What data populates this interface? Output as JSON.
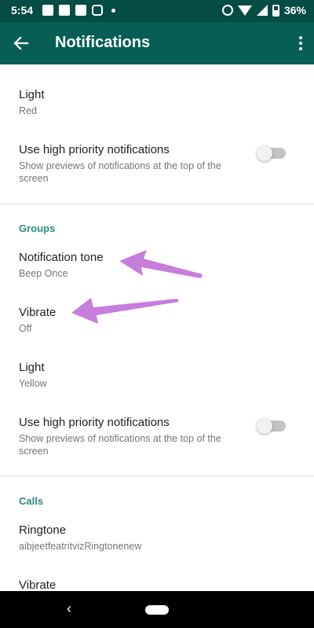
{
  "status_bar": {
    "time": "5:54",
    "battery": "36%",
    "left_icons": [
      "message-icon",
      "message-icon",
      "news-icon",
      "instagram-icon"
    ],
    "right_icons": [
      "alarm-icon",
      "wifi-icon",
      "signal-icon",
      "battery-icon"
    ]
  },
  "app_bar": {
    "title": "Notifications",
    "color": "#075e54"
  },
  "sections": {
    "top": {
      "light": {
        "title": "Light",
        "value": "Red"
      },
      "high_priority": {
        "title": "Use high priority notifications",
        "subtitle": "Show previews of notifications at the top of the screen",
        "enabled": false
      }
    },
    "groups": {
      "header": "Groups",
      "notification_tone": {
        "title": "Notification tone",
        "value": "Beep Once"
      },
      "vibrate": {
        "title": "Vibrate",
        "value": "Off"
      },
      "light": {
        "title": "Light",
        "value": "Yellow"
      },
      "high_priority": {
        "title": "Use high priority notifications",
        "subtitle": "Show previews of notifications at the top of the screen",
        "enabled": false
      }
    },
    "calls": {
      "header": "Calls",
      "ringtone": {
        "title": "Ringtone",
        "value": "aibjeetfeatritvizRingtonenew"
      },
      "vibrate": {
        "title": "Vibrate"
      }
    }
  },
  "annotations": {
    "arrow_color": "#c77ddb"
  },
  "nav": {
    "back_glyph": "‹"
  }
}
